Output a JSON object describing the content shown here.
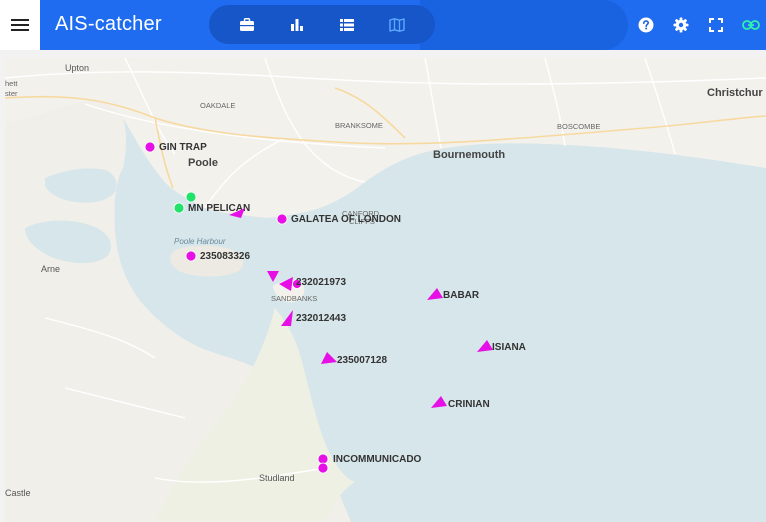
{
  "app": {
    "title": "AIS-catcher"
  },
  "nav_tabs": [
    {
      "name": "dashboard",
      "icon": "briefcase-icon"
    },
    {
      "name": "plots",
      "icon": "bar-chart-icon"
    },
    {
      "name": "vessel-list",
      "icon": "list-icon"
    },
    {
      "name": "map",
      "icon": "map-icon",
      "active": true
    }
  ],
  "toolbar": [
    {
      "name": "help",
      "icon": "help-icon"
    },
    {
      "name": "settings",
      "icon": "gear-icon"
    },
    {
      "name": "fullscreen",
      "icon": "fullscreen-icon"
    },
    {
      "name": "link",
      "icon": "link-icon"
    }
  ],
  "colors": {
    "topbar": "#1f6cf0",
    "water": "#d7e6ea",
    "land": "#f3f1ec",
    "vessel_magenta": "#e60fe6",
    "vessel_green": "#22e36a"
  },
  "places": {
    "upton": "Upton",
    "hett": "hett",
    "ster": "ster",
    "oakdale": "OAKDALE",
    "branksome": "BRANKSOME",
    "boscombe": "BOSCOMBE",
    "christchurch": "Christchur",
    "poole": "Poole",
    "bournemouth": "Bournemouth",
    "canford_cliffs_1": "CANFORD",
    "canford_cliffs_2": "CLIFFS",
    "poole_harbour": "Poole Harbour",
    "arne": "Arne",
    "sandbanks": "SANDBANKS",
    "studland": "Studland",
    "castle": "Castle"
  },
  "vessels": [
    {
      "label": "GIN TRAP",
      "kind": "dot",
      "color": "magenta"
    },
    {
      "label": "MN PELICAN",
      "kind": "dot",
      "color": "green"
    },
    {
      "label": "GALATEA OF LONDON",
      "kind": "dot",
      "color": "magenta"
    },
    {
      "label": "235083326",
      "kind": "dot",
      "color": "magenta"
    },
    {
      "label": "232021973",
      "kind": "dot",
      "color": "magenta"
    },
    {
      "label": "232012443",
      "kind": "arrow",
      "color": "magenta"
    },
    {
      "label": "235007128",
      "kind": "arrow",
      "color": "magenta"
    },
    {
      "label": "BABAR",
      "kind": "arrow",
      "color": "magenta"
    },
    {
      "label": "ISIANA",
      "kind": "arrow",
      "color": "magenta"
    },
    {
      "label": "CRINIAN",
      "kind": "arrow",
      "color": "magenta"
    },
    {
      "label": "INCOMMUNICADO",
      "kind": "dot",
      "color": "magenta"
    }
  ]
}
